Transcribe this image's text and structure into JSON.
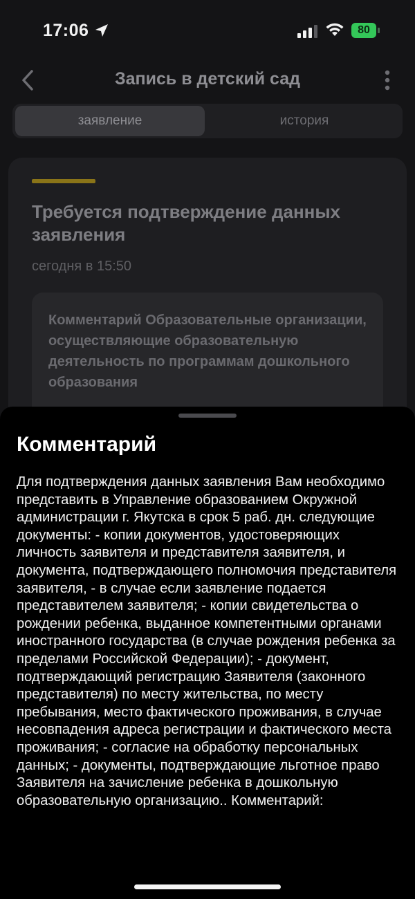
{
  "status_bar": {
    "time": "17:06",
    "battery": "80",
    "icons": [
      "location-arrow-icon",
      "cellular-signal-icon",
      "wifi-icon",
      "battery-charging-icon"
    ],
    "battery_color": "#34c759"
  },
  "nav": {
    "title": "Запись в детский сад",
    "back_icon": "chevron-left-icon",
    "more_icon": "more-vertical-icon"
  },
  "tabs": [
    {
      "label": "заявление",
      "active": true
    },
    {
      "label": "история",
      "active": false
    }
  ],
  "card": {
    "accent_color": "#8a7418",
    "title": "Требуется подтверждение данных заявления",
    "time": "сегодня в 15:50",
    "comment_preview": "Комментарий Образовательные организации, осуществляющие образовательную деятельность по программам дошкольного образования"
  },
  "sheet": {
    "title": "Комментарий",
    "body": "Для подтверждения данных заявления Вам необходимо представить в Управление образованием Окружной администрации г. Якутска в срок 5 раб. дн. следующие документы: - копии документов, удостоверяющих личность заявителя и представителя заявителя, и документа, подтверждающего полномочия представителя заявителя, - в случае если заявление подается представителем заявителя; - копии свидетельства о рождении ребенка, выданное компетентными органами иностранного государства (в случае рождения ребенка за пределами Российской Федерации); - документ, подтверждающий регистрацию Заявителя (законного представителя) по месту жительства, по месту пребывания, место фактического проживания, в случае несовпадения адреса регистрации и фактического места проживания; - согласие на обработку персональных данных; - документы, подтверждающие льготное право Заявителя на зачисление ребенка в дошкольную образовательную организацию.. Комментарий:"
  }
}
